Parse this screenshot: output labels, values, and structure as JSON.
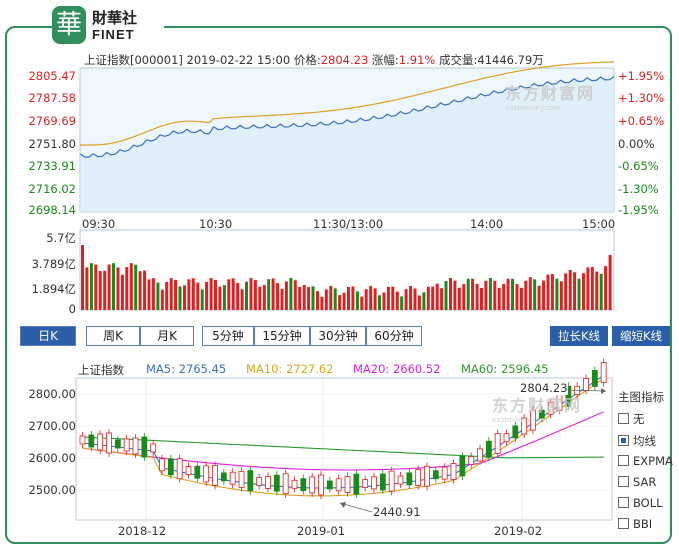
{
  "logo": {
    "mark": "華",
    "cn": "財華社",
    "en": "FINET"
  },
  "info": {
    "name": "上证指数[000001]",
    "time": "2019-02-22 15:00",
    "price_label": "价格:",
    "price": "2804.23",
    "change_label": "涨幅:",
    "change": "1.91%",
    "volume_label": "成交量:",
    "volume": "41446.79万"
  },
  "intraday": {
    "left_axis": [
      "2805.47",
      "2787.58",
      "2769.69",
      "2751.80",
      "2733.91",
      "2716.02",
      "2698.14"
    ],
    "right_axis": [
      "+1.95%",
      "+1.30%",
      "+0.65%",
      "0.00%",
      "-0.65%",
      "-1.30%",
      "-1.95%"
    ],
    "time_axis": [
      "09:30",
      "10:30",
      "11:30/13:00",
      "14:00",
      "15:00"
    ],
    "vol_axis": [
      "5.7亿",
      "3.789亿",
      "1.894亿",
      "0"
    ],
    "watermark": "东方财富网",
    "watermark_sub": "eastmoney.com"
  },
  "kline_tabs": [
    "日K",
    "周K",
    "月K",
    "5分钟",
    "15分钟",
    "30分钟",
    "60分钟"
  ],
  "buttons": {
    "stretch": "拉长K线",
    "shorten": "缩短K线"
  },
  "ma_bar": {
    "name": "上证指数",
    "ma5": "MA5: 2765.45",
    "ma10": "MA10: 2727.62",
    "ma20": "MA20: 2660.52",
    "ma60": "MA60: 2596.45"
  },
  "kline": {
    "y_axis": [
      "2800.00",
      "2700.00",
      "2600.00",
      "2500.00"
    ],
    "x_axis": [
      "2018-12",
      "2019-01",
      "2019-02"
    ],
    "high_label": "2804.23",
    "low_label": "2440.91"
  },
  "side_panel": {
    "title": "主图指标",
    "options": [
      "无",
      "均线",
      "EXPMA",
      "SAR",
      "BOLL",
      "BBI"
    ],
    "selected": "均线"
  },
  "colors": {
    "up": "#e02020",
    "down": "#1a8a1a",
    "ma5": "#3a6fc4",
    "ma10": "#e0a020",
    "ma20": "#e020e0",
    "ma60": "#2a9a2a",
    "accent": "#2b5ea8"
  }
}
